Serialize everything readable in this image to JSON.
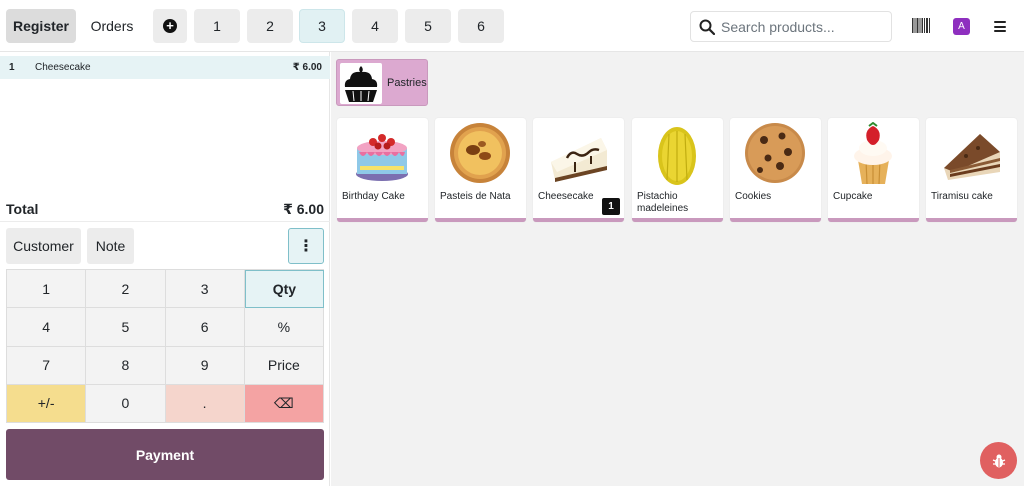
{
  "navbar": {
    "register_label": "Register",
    "orders_label": "Orders",
    "add_order_icon": "plus-circle-icon",
    "tabs": [
      "1",
      "2",
      "3",
      "4",
      "5",
      "6"
    ],
    "active_tab": "3",
    "search_placeholder": "Search products...",
    "avatar_letter": "A",
    "avatar_color": "#8e2fbf"
  },
  "order": {
    "lines": [
      {
        "qty": "1",
        "name": "Cheesecake",
        "price": "₹ 6.00"
      }
    ],
    "total_label": "Total",
    "total_value": "₹ 6.00"
  },
  "controls": {
    "customer_label": "Customer",
    "note_label": "Note",
    "more_label": "⋮"
  },
  "numpad": {
    "keys": [
      "1",
      "2",
      "3",
      "Qty",
      "4",
      "5",
      "6",
      "%",
      "7",
      "8",
      "9",
      "Price",
      "+/-",
      "0",
      ".",
      "⌫"
    ]
  },
  "payment_label": "Payment",
  "category": {
    "label": "Pastries"
  },
  "products": [
    {
      "name": "Birthday Cake"
    },
    {
      "name": "Pasteis de Nata"
    },
    {
      "name": "Cheesecake",
      "badge": "1"
    },
    {
      "name": "Pistachio madeleines"
    },
    {
      "name": "Cookies"
    },
    {
      "name": "Cupcake"
    },
    {
      "name": "Tiramisu cake"
    }
  ],
  "colors": {
    "primary": "#714b67",
    "category_bg": "#dca9d0",
    "selected_line": "#e6f3f5",
    "backspace_key": "#f4a3a3",
    "sign_key": "#f5dd8e",
    "bug_button": "#e06060"
  }
}
